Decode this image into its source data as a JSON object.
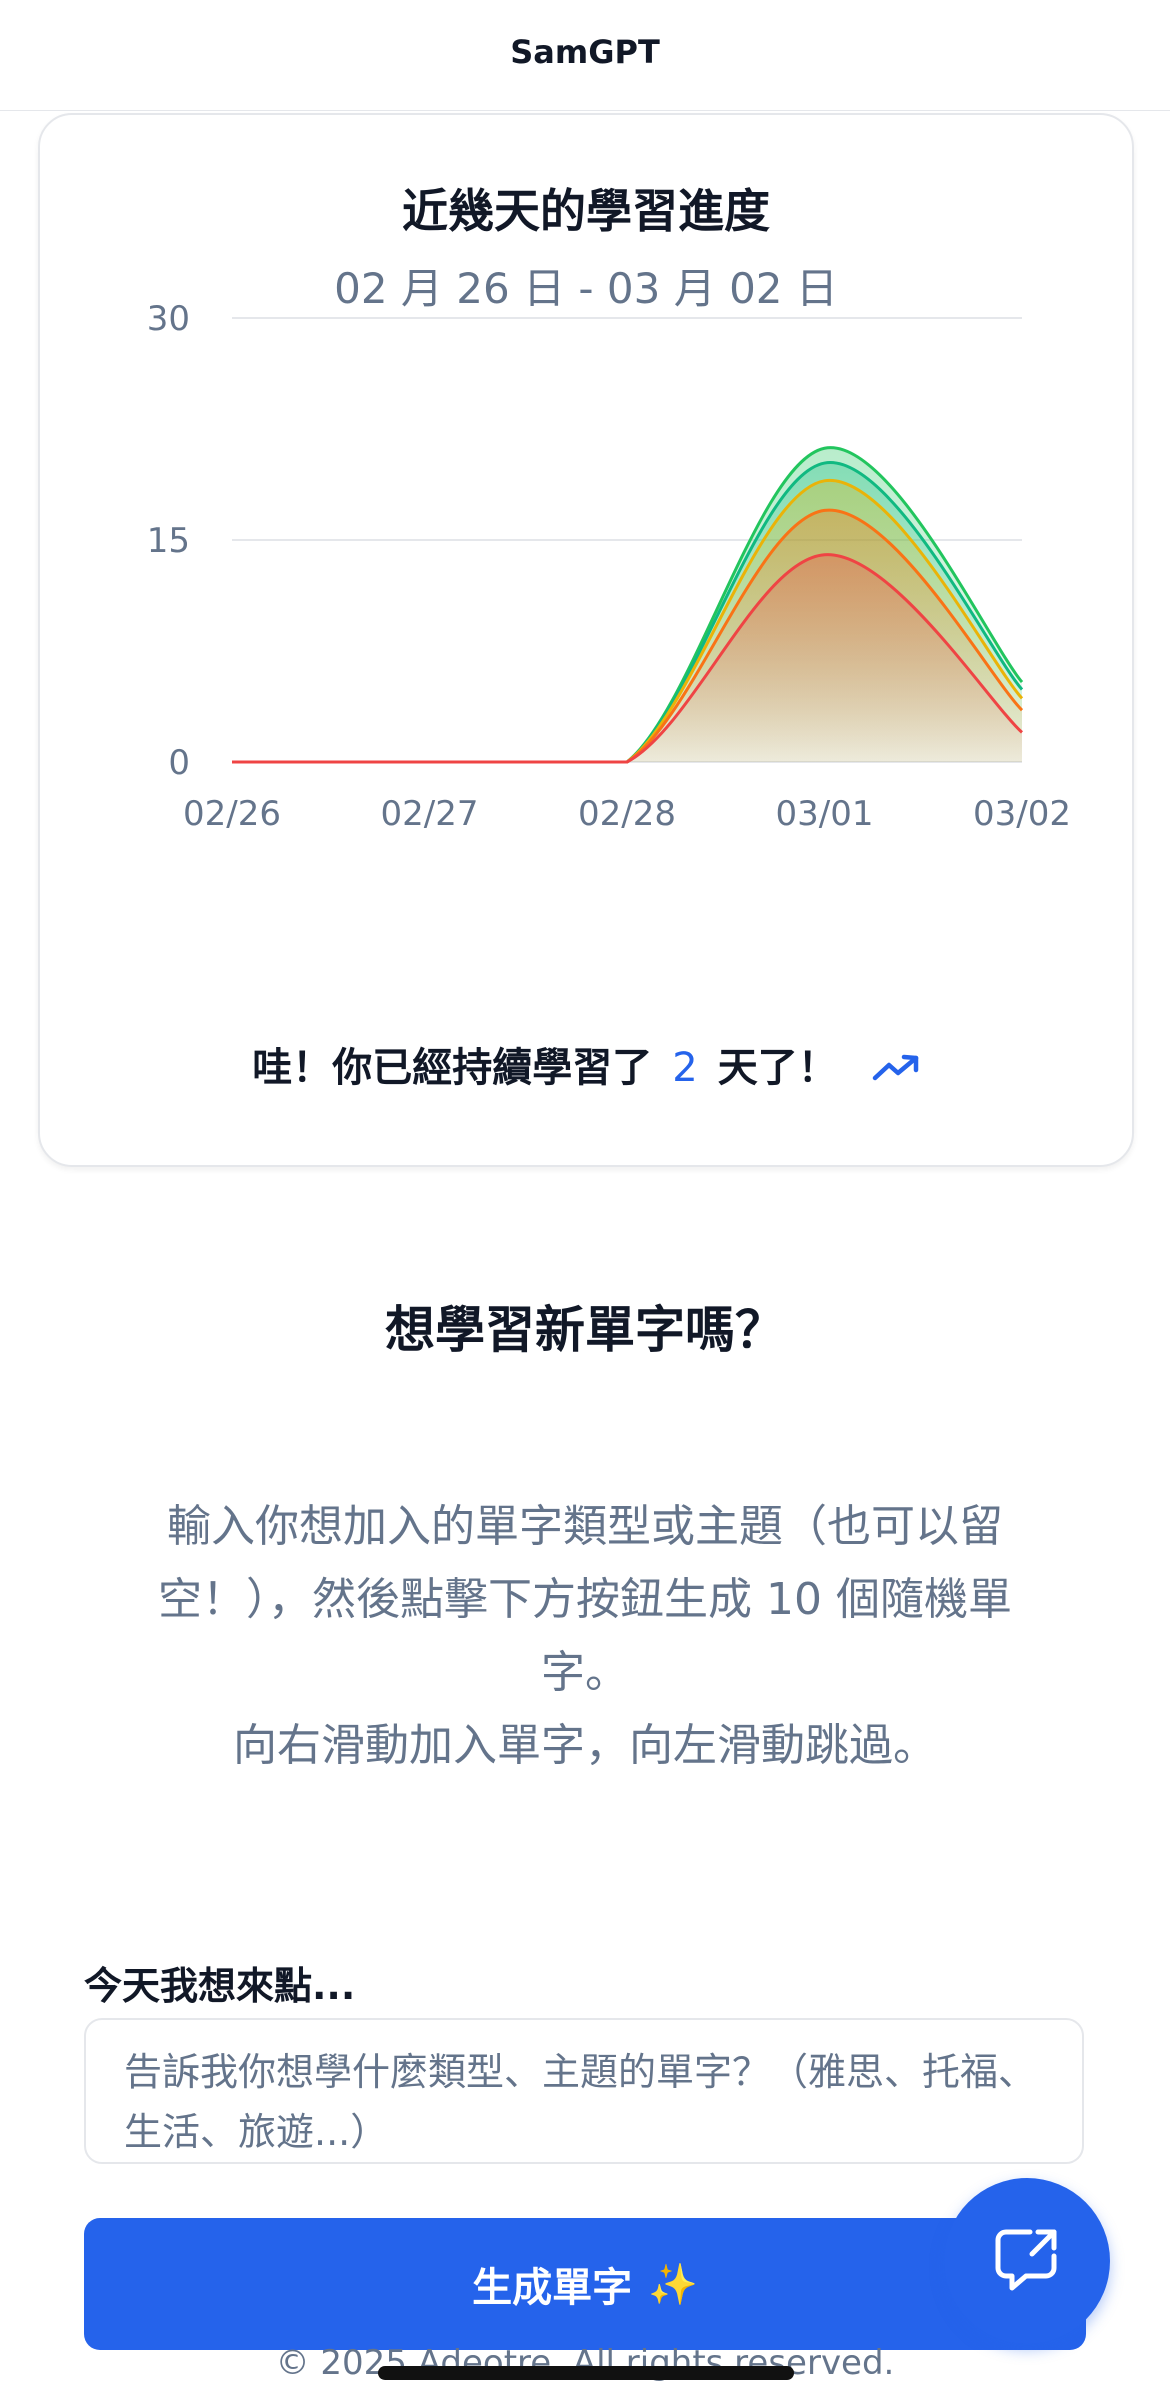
{
  "app": {
    "title": "SamGPT"
  },
  "progress": {
    "title": "近幾天的學習進度",
    "date_range": "02 月 26 日 - 03 月 02 日",
    "streak_prefix": "哇！你已經持續學習了",
    "streak_days": "2",
    "streak_suffix": "天了！",
    "trend_icon": "trending-up-icon"
  },
  "chart_data": {
    "type": "area",
    "stacked": true,
    "title": "近幾天的學習進度",
    "subtitle": "02 月 26 日 - 03 月 02 日",
    "x": [
      "02/26",
      "02/27",
      "02/28",
      "03/01",
      "03/02"
    ],
    "ylim": [
      0,
      30
    ],
    "yticks": [
      "0",
      "15",
      "30"
    ],
    "grid": true,
    "legend": "none",
    "series": [
      {
        "values": [
          0,
          0,
          0,
          14,
          2
        ],
        "color": "#ef4444"
      },
      {
        "values": [
          0,
          0,
          0,
          3,
          1.5
        ],
        "color": "#f97316"
      },
      {
        "values": [
          0,
          0,
          0,
          2,
          0.8
        ],
        "color": "#eab308"
      },
      {
        "values": [
          0,
          0,
          0,
          1.2,
          0.6
        ],
        "color": "#10b981"
      },
      {
        "values": [
          0,
          0,
          0,
          1,
          0.5
        ],
        "color": "#22c55e"
      }
    ]
  },
  "learn": {
    "title": "想學習新單字嗎？",
    "desc_lines": [
      "輸入你想加入的單字類型或主題（也可以留",
      "空！），然後點擊下方按鈕生成 10 個隨機單",
      "字。",
      "向右滑動加入單字，向左滑動跳過。"
    ]
  },
  "input": {
    "label": "今天我想來點...",
    "placeholder": "告訴我你想學什麼類型、主題的單字？（雅思、托福、生活、旅遊...）"
  },
  "generate_button": {
    "label": "生成單字",
    "icon": "sparkles-icon"
  },
  "fab": {
    "icon": "share-chat-icon"
  },
  "footer": {
    "text": "© 2025 Adeotre. All rights reserved."
  },
  "colors": {
    "accent": "#2563eb",
    "muted": "#64748b"
  }
}
